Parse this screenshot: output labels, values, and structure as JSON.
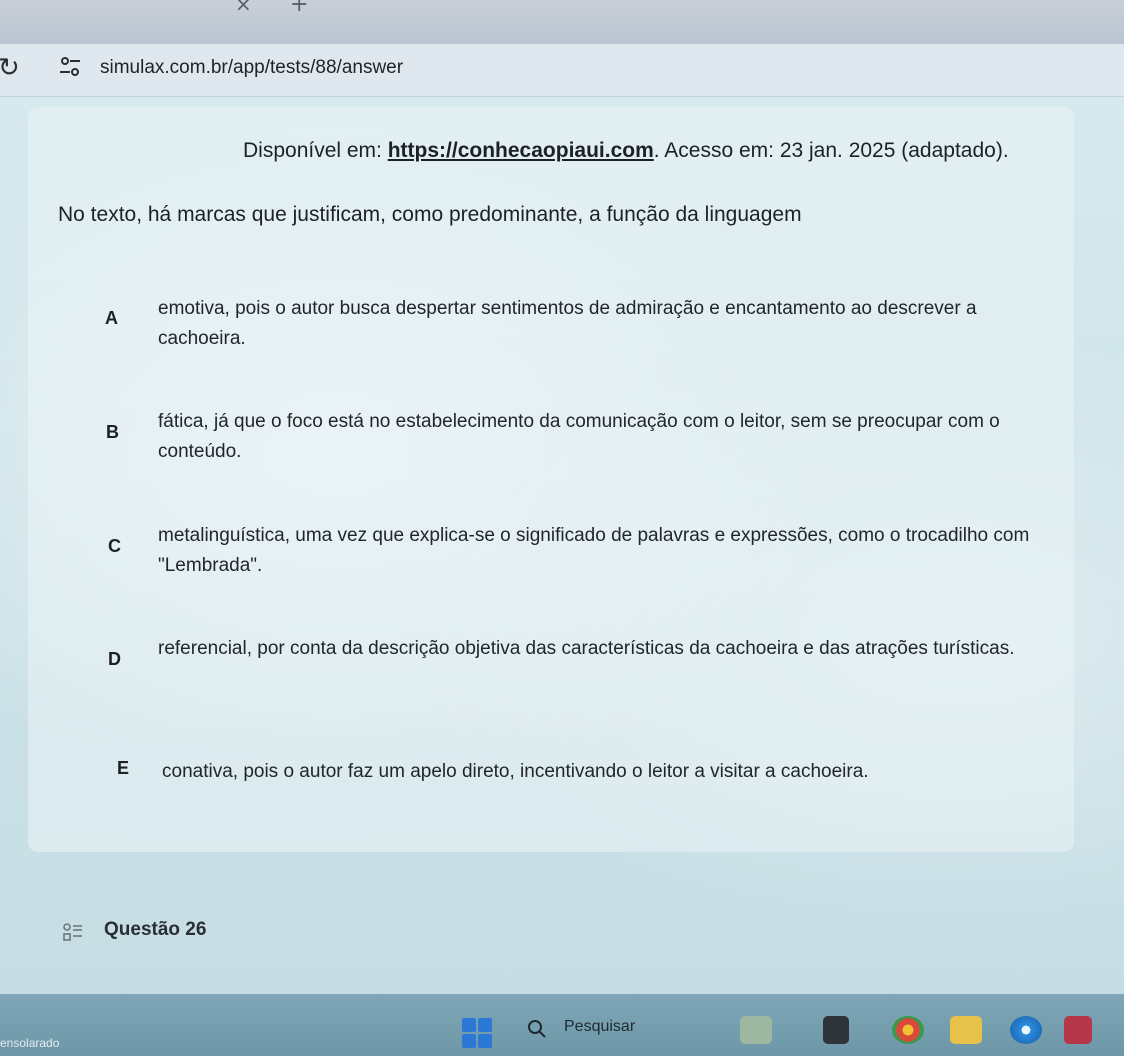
{
  "browser": {
    "url": "simulax.com.br/app/tests/88/answer"
  },
  "question": {
    "source_prefix": "Disponível em: ",
    "source_link": "https://conhecaopiaui.com",
    "source_suffix": ". Acesso em: 23 jan. 2025 (adaptado).",
    "prompt": "No texto, há marcas que justificam, como predominante, a função da linguagem",
    "options": [
      {
        "letter": "A",
        "text": "emotiva, pois o autor busca despertar sentimentos de admiração e encantamento ao descrever a cachoeira."
      },
      {
        "letter": "B",
        "text": "fática, já que o foco está no estabelecimento da comunicação com o leitor, sem se preocupar com o conteúdo."
      },
      {
        "letter": "C",
        "text": "metalinguística, uma vez que explica-se o significado de palavras e expressões, como o trocadilho com \"Lembrada\"."
      },
      {
        "letter": "D",
        "text": "referencial, por conta da descrição objetiva das características da cachoeira e das atrações turísticas."
      },
      {
        "letter": "E",
        "text": "conativa, pois o autor faz um apelo direto, incentivando o leitor a visitar a cachoeira."
      }
    ]
  },
  "next_question": {
    "label": "Questão 26",
    "icon": "question-list-icon"
  },
  "taskbar": {
    "weather_text": "ensolarado",
    "search_placeholder": "Pesquisar",
    "apps": [
      "file-explorer-icon",
      "media-icon",
      "chrome-icon",
      "folder-icon",
      "browser-icon",
      "store-icon"
    ]
  },
  "colors": {
    "page_bg": "#d4e6ea",
    "text": "#1d2126",
    "taskbar": "#7ea6b6"
  }
}
